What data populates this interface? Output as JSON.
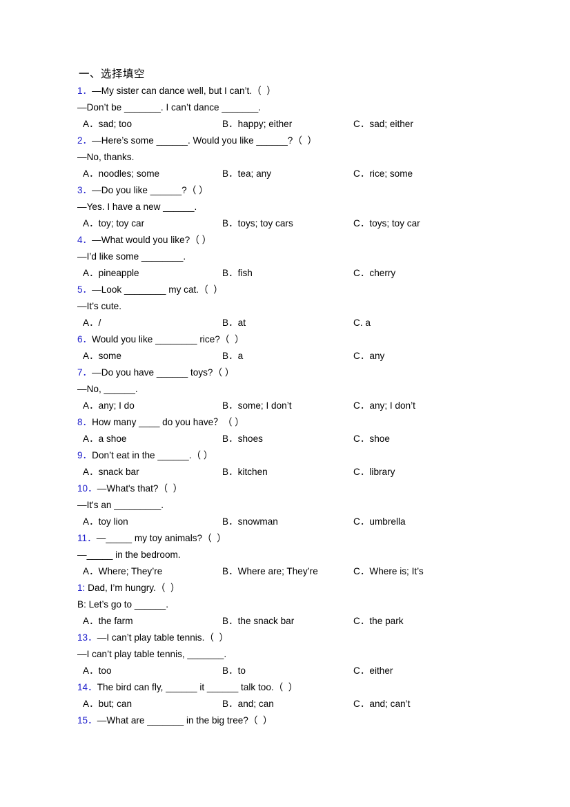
{
  "section": {
    "title": "一、选择填空"
  },
  "questions": [
    {
      "number": "1．",
      "stem": "—My sister can dance well, but I can’t.（  ）",
      "continuation": "—Don’t be _______. I can’t dance _______.",
      "options": {
        "a": "A．sad; too",
        "b": "B．happy; either",
        "c": "C．sad; either"
      }
    },
    {
      "number": "2．",
      "stem": "—Here’s some ______. Would you like ______?（  ）",
      "continuation": "—No, thanks.",
      "options": {
        "a": "A．noodles; some",
        "b": "B．tea; any",
        "c": "C．rice; some"
      }
    },
    {
      "number": "3．",
      "stem": "—Do you like ______?（ ）",
      "continuation": "—Yes. I have a new ______.",
      "options": {
        "a": "A．toy; toy car",
        "b": "B．toys; toy cars",
        "c": "C．toys; toy car"
      }
    },
    {
      "number": "4．",
      "stem": "—What would you like?（ ）",
      "continuation": "—I’d like some ________.",
      "options": {
        "a": "A．pineapple",
        "b": "B．fish",
        "c": "C．cherry"
      }
    },
    {
      "number": "5．",
      "stem": "—Look ________ my cat.（  ）",
      "continuation": "—It’s cute.",
      "options": {
        "a": "A．/",
        "b": "B．at",
        "c": "C. a"
      }
    },
    {
      "number": "6．",
      "stem": "Would you like ________ rice?（  ）",
      "continuation": "",
      "options": {
        "a": "A．some",
        "b": "B．a",
        "c": "C．any"
      }
    },
    {
      "number": "7．",
      "stem": "—Do you have ______ toys?（ ）",
      "continuation": "—No, ______.",
      "options": {
        "a": "A．any; I do",
        "b": "B．some; I don’t",
        "c": "C．any; I don’t"
      }
    },
    {
      "number": "8．",
      "stem": "How many ____ do you have？（ ）",
      "continuation": "",
      "options": {
        "a": "A．a shoe",
        "b": "B．shoes",
        "c": "C．shoe"
      }
    },
    {
      "number": "9．",
      "stem": "Don’t eat in the ______.（ ）",
      "continuation": "",
      "options": {
        "a": "A．snack bar",
        "b": "B．kitchen",
        "c": "C．library"
      }
    },
    {
      "number": "10．",
      "stem": "—What's that?（  ）",
      "continuation": "—It's an _________.",
      "options": {
        "a": "A．toy lion",
        "b": "B．snowman",
        "c": "C．umbrella"
      }
    },
    {
      "number": "11．",
      "stem": "—_____ my toy animals?（  ）",
      "continuation": "—_____ in the bedroom.",
      "options": {
        "a": "A．Where; They’re",
        "b": "B．Where are; They’re",
        "c": "C．Where is; It’s"
      }
    },
    {
      "number": "1:",
      "stem": " Dad, I’m hungry.（  ）",
      "continuation": "B: Let’s go to ______.",
      "options": {
        "a": "A．the farm",
        "b": "B．the snack bar",
        "c": "C．the park"
      }
    },
    {
      "number": "13．",
      "stem": "—I can’t play table tennis.（  ）",
      "continuation": "—I can’t play table tennis, _______.",
      "options": {
        "a": "A．too",
        "b": "B．to",
        "c": "C．either"
      }
    },
    {
      "number": "14．",
      "stem": "The bird can fly, ______ it ______ talk too.（  ）",
      "continuation": "",
      "options": {
        "a": "A．but; can",
        "b": "B．and; can",
        "c": "C．and; can’t"
      }
    },
    {
      "number": "15．",
      "stem": "—What are _______ in the big tree?（  ）",
      "continuation": "",
      "options": {
        "a": "",
        "b": "",
        "c": ""
      }
    }
  ],
  "colors": {
    "number_blue": "#2020cc",
    "text_black": "#000000",
    "page_background": "#ffffff"
  }
}
